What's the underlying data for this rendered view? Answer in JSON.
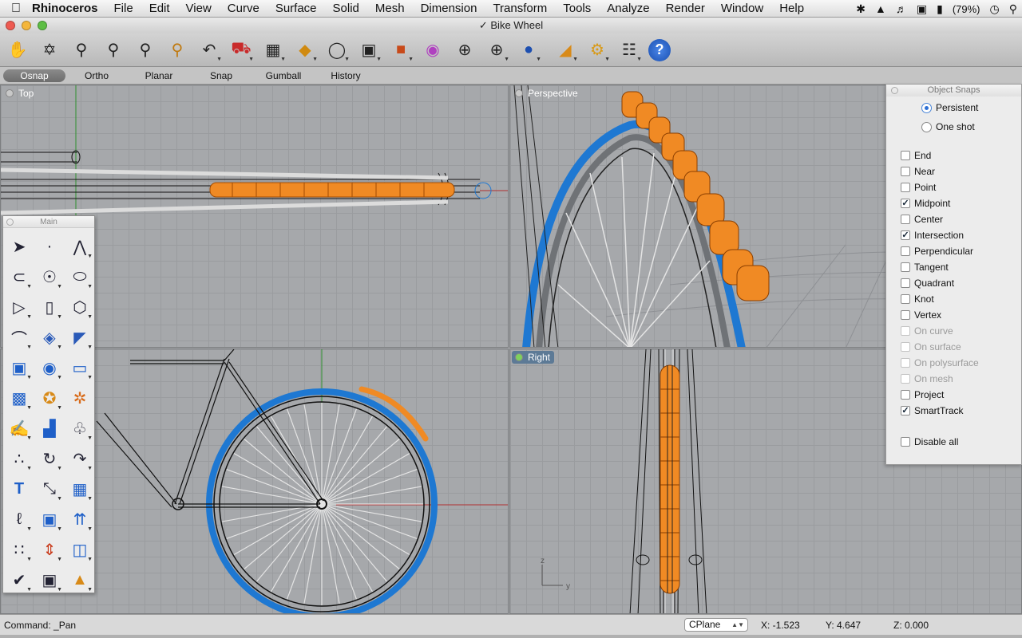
{
  "menubar": {
    "app_name": "Rhinoceros",
    "items": [
      "File",
      "Edit",
      "View",
      "Curve",
      "Surface",
      "Solid",
      "Mesh",
      "Dimension",
      "Transform",
      "Tools",
      "Analyze",
      "Render",
      "Window",
      "Help"
    ],
    "battery": "(79%)"
  },
  "window": {
    "title": "Bike Wheel"
  },
  "toolbar": {
    "icons": [
      "pan-hand-icon",
      "rotate-view-icon",
      "zoom-dynamic-icon",
      "zoom-window-icon",
      "zoom-extents-icon",
      "zoom-selected-icon",
      "undo-view-icon",
      "named-views-car-icon",
      "cplane-grid-icon",
      "set-cplane-icon",
      "light-bulb-icon",
      "lock-icon",
      "layer-icon",
      "color-wheel-icon",
      "wireframe-sphere-icon",
      "shaded-sphere-icon",
      "rendered-sphere-icon",
      "render-icon",
      "options-gear-icon",
      "properties-tree-icon",
      "help-icon"
    ]
  },
  "modes": {
    "osnap": "Osnap",
    "ortho": "Ortho",
    "planar": "Planar",
    "snap": "Snap",
    "gumball": "Gumball",
    "history": "History"
  },
  "viewports": {
    "top": "Top",
    "perspective": "Perspective",
    "front": "",
    "right": "Right",
    "right_axis_z": "z",
    "right_axis_y": "y"
  },
  "palette": {
    "title": "Main"
  },
  "osnap_panel": {
    "title": "Object Snaps",
    "persistent": "Persistent",
    "one_shot": "One shot",
    "snaps": [
      {
        "label": "End",
        "checked": false,
        "enabled": true
      },
      {
        "label": "Near",
        "checked": false,
        "enabled": true
      },
      {
        "label": "Point",
        "checked": false,
        "enabled": true
      },
      {
        "label": "Midpoint",
        "checked": true,
        "enabled": true
      },
      {
        "label": "Center",
        "checked": false,
        "enabled": true
      },
      {
        "label": "Intersection",
        "checked": true,
        "enabled": true
      },
      {
        "label": "Perpendicular",
        "checked": false,
        "enabled": true
      },
      {
        "label": "Tangent",
        "checked": false,
        "enabled": true
      },
      {
        "label": "Quadrant",
        "checked": false,
        "enabled": true
      },
      {
        "label": "Knot",
        "checked": false,
        "enabled": true
      },
      {
        "label": "Vertex",
        "checked": false,
        "enabled": true
      },
      {
        "label": "On curve",
        "checked": false,
        "enabled": false
      },
      {
        "label": "On surface",
        "checked": false,
        "enabled": false
      },
      {
        "label": "On polysurface",
        "checked": false,
        "enabled": false
      },
      {
        "label": "On mesh",
        "checked": false,
        "enabled": false
      },
      {
        "label": "Project",
        "checked": false,
        "enabled": true
      },
      {
        "label": "SmartTrack",
        "checked": true,
        "enabled": true
      }
    ],
    "disable_all": "Disable all"
  },
  "status": {
    "command": "Command: _Pan",
    "cplane": "CPlane",
    "x": "X: -1.523",
    "y": "Y: 4.647",
    "z": "Z: 0.000"
  },
  "colors": {
    "accent_orange": "#f08a24",
    "tire_blue": "#1e78d2",
    "viewport_bg": "#a6a8ab"
  }
}
